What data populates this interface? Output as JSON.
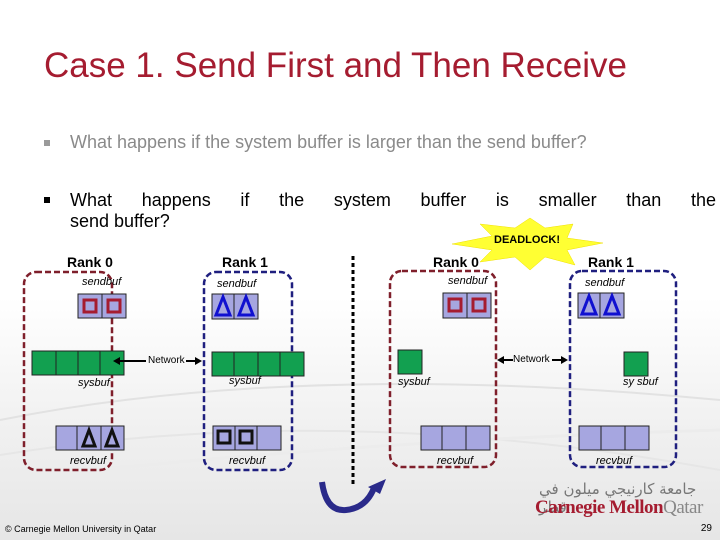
{
  "slide": {
    "title": "Case 1. Send First and Then Receive",
    "bullets": [
      {
        "text": "What happens if the system buffer is larger than the send buffer?",
        "state": "dimmed"
      },
      {
        "text_line1": "What happens if the system buffer is smaller than the",
        "text_line2": "send buffer?",
        "state": "active"
      }
    ],
    "page_number": "29",
    "footer": "© Carnegie Mellon University in Qatar",
    "logo": {
      "arabic": "جامعة كارنيجي ميلون في قطر",
      "english_main": "Carnegie Mellon",
      "english_suffix": "Qatar"
    },
    "colors": {
      "title": "#a51c30",
      "rank0_border": "#7f1f2b",
      "rank1_border": "#1f1f7f",
      "sysbuf": "#12a050",
      "buffer_cell": "#a6a6e0",
      "square_glyph": "#a51c30",
      "triangle_glyph": "#1010d0",
      "deadlock_burst": "#ffff33",
      "swap_arrow": "#2a2a8a"
    }
  },
  "diagram": {
    "left_case": {
      "network_label": "Network",
      "rank0": {
        "label": "Rank 0",
        "sendbuf_label": "sendbuf",
        "sysbuf_label": "sysbuf",
        "recvbuf_label": "recvbuf",
        "sendbuf_cells": [
          "square",
          "square"
        ],
        "sysbuf_cells": 4,
        "recvbuf_cells": [
          "empty",
          "triangle",
          "triangle"
        ]
      },
      "rank1": {
        "label": "Rank 1",
        "sendbuf_label": "sendbuf",
        "sysbuf_label": "sysbuf",
        "recvbuf_label": "recvbuf",
        "sendbuf_cells": [
          "triangle",
          "triangle"
        ],
        "sysbuf_cells": 4,
        "recvbuf_cells": [
          "square",
          "square",
          "empty"
        ]
      }
    },
    "right_case": {
      "network_label": "Network",
      "deadlock_label": "DEADLOCK!",
      "rank0": {
        "label": "Rank 0",
        "sendbuf_label": "sendbuf",
        "sysbuf_label": "sysbuf",
        "recvbuf_label": "recvbuf",
        "sendbuf_cells": [
          "square",
          "square"
        ],
        "sysbuf_cells": 1,
        "recvbuf_cells": [
          "empty",
          "empty",
          "empty"
        ]
      },
      "rank1": {
        "label": "Rank 1",
        "sendbuf_label": "sendbuf",
        "sysbuf_label": "sy sbuf",
        "recvbuf_label": "recvbuf",
        "sendbuf_cells": [
          "triangle",
          "triangle"
        ],
        "sysbuf_cells": 1,
        "recvbuf_cells": [
          "empty",
          "empty",
          "empty"
        ]
      }
    }
  }
}
